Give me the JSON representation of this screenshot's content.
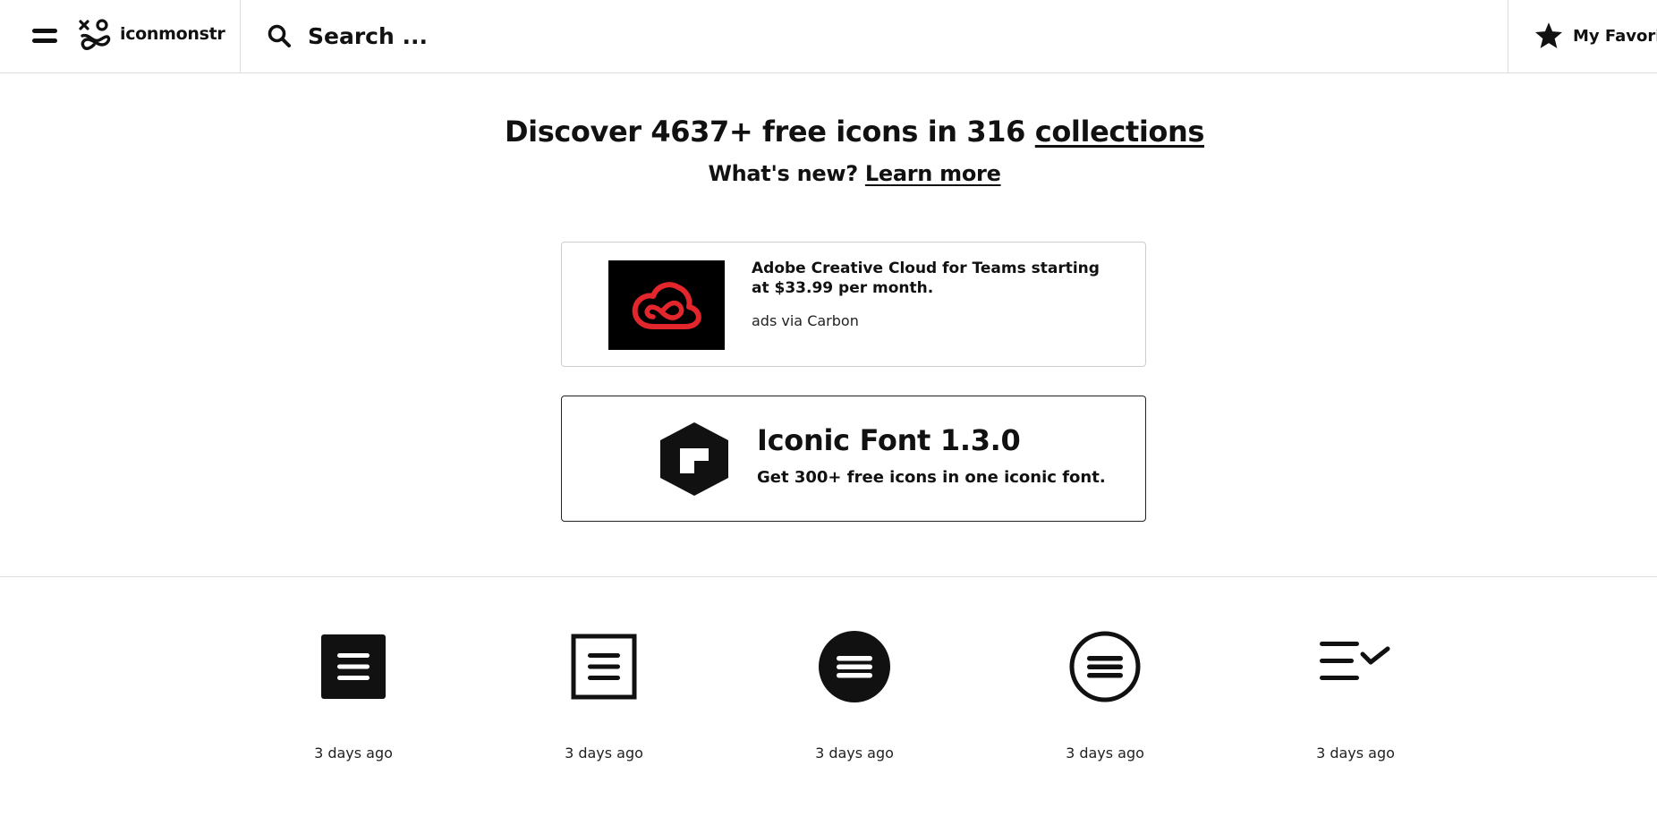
{
  "header": {
    "logo_text": "iconmonstr",
    "search_placeholder": "Search ...",
    "favorites_label": "My Favorites"
  },
  "hero": {
    "title_prefix": "Discover 4637+ free icons in 316",
    "title_link": "collections",
    "subtitle_prefix": "What's new?",
    "subtitle_link": "Learn more"
  },
  "ad": {
    "text": "Adobe Creative Cloud for Teams starting at $33.99 per month.",
    "via": "ads via Carbon"
  },
  "promo": {
    "title": "Iconic Font 1.3.0",
    "subtitle": "Get 300+ free icons in one iconic font."
  },
  "icons": [
    {
      "icon": "text-square-filled-icon",
      "date": "3 days ago"
    },
    {
      "icon": "text-square-outline-icon",
      "date": "3 days ago"
    },
    {
      "icon": "text-circle-filled-icon",
      "date": "3 days ago"
    },
    {
      "icon": "text-circle-outline-icon",
      "date": "3 days ago"
    },
    {
      "icon": "list-chevron-icon",
      "date": "3 days ago"
    }
  ]
}
